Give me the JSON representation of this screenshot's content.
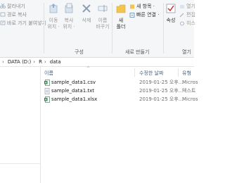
{
  "ribbon": {
    "clipboard": {
      "cut": "잘라내기",
      "copy_path": "경로 복사",
      "paste_shortcut": "바로 가기 붙여넣기"
    },
    "organize": {
      "move_to_line1": "이동",
      "move_to_line2": "위치 ·",
      "copy_to_line1": "복사",
      "copy_to_line2": "위치 ·",
      "delete": "삭제",
      "rename_line1": "이름",
      "rename_line2": "바꾸기",
      "group_label": "구성"
    },
    "new": {
      "new_folder_line1": "새",
      "new_folder_line2": "폴더",
      "new_item": "새 항목 ·",
      "easy_access": "빠른 연결 ·",
      "group_label": "새로 만들기"
    },
    "open": {
      "properties": "속성",
      "open": "열기",
      "edit": "편집",
      "history": "히스",
      "group_label": "열기"
    }
  },
  "address": {
    "crumbs": [
      "DATA (D:)",
      "R",
      "data"
    ]
  },
  "columns": {
    "name": "이름",
    "date": "수정한 날짜",
    "type": "유형"
  },
  "files": [
    {
      "name": "sample_data1.csv",
      "date": "2019-01-25 오후...",
      "type": "Micros",
      "icon": "excel-csv-icon"
    },
    {
      "name": "sample_data1.txt",
      "date": "2019-01-25 오후...",
      "type": "텍스트",
      "icon": "text-file-icon"
    },
    {
      "name": "sample_data1.xlsx",
      "date": "2019-01-25 오후...",
      "type": "Micros",
      "icon": "excel-icon"
    }
  ],
  "colors": {
    "excel_green": "#1d7a45",
    "ribbon_bg": "#f5f6f7",
    "header_text": "#4c607a",
    "folder_yellow": "#f3c54b"
  }
}
